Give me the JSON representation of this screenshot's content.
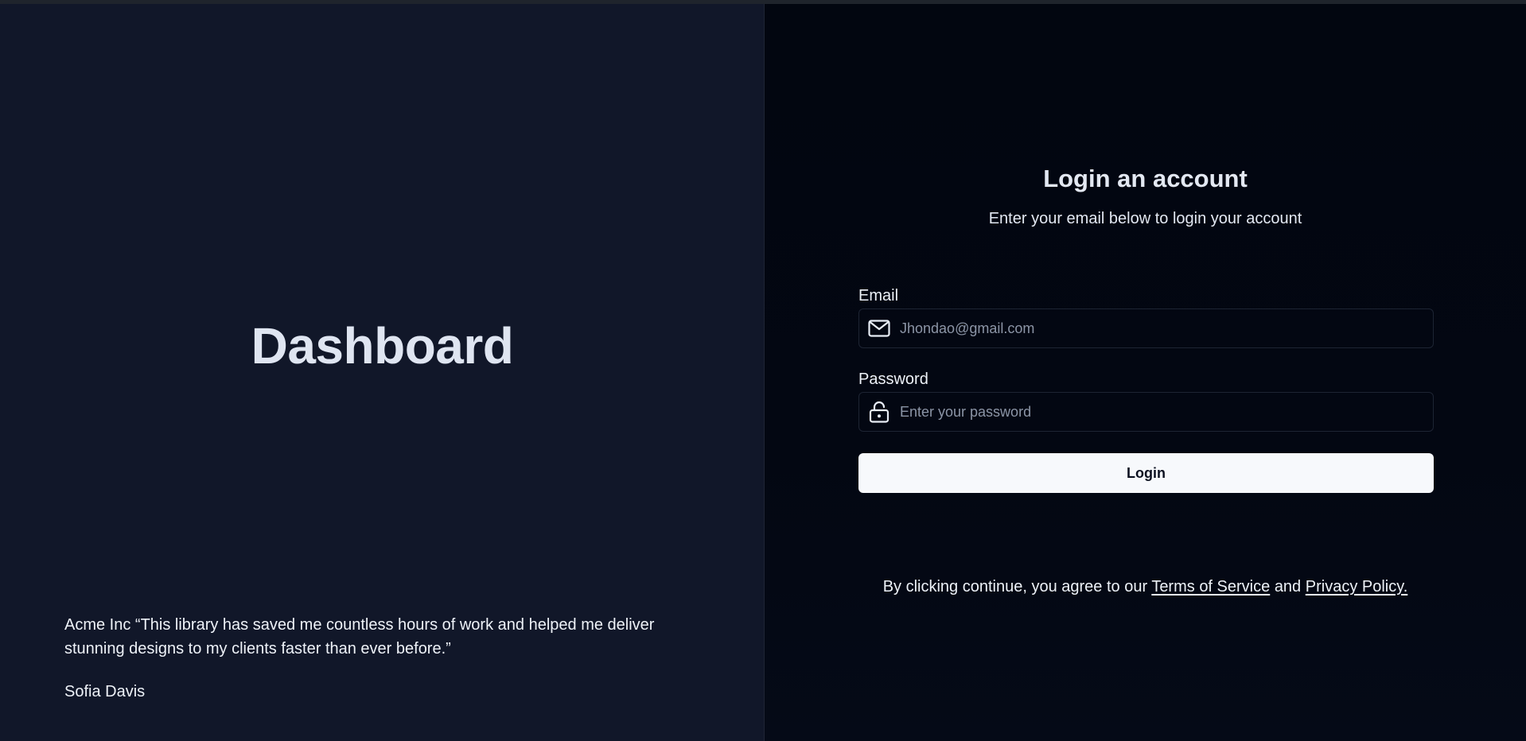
{
  "left": {
    "brand_title": "Dashboard",
    "testimonial": {
      "quote": "Acme Inc “This library has saved me countless hours of work and helped me deliver stunning designs to my clients faster than ever before.”",
      "author": "Sofia Davis"
    }
  },
  "form": {
    "title": "Login an account",
    "subtitle": "Enter your email below to login your account",
    "email": {
      "label": "Email",
      "placeholder": "Jhondao@gmail.com",
      "value": "",
      "icon": "mail-icon"
    },
    "password": {
      "label": "Password",
      "placeholder": "Enter your password",
      "value": "",
      "icon": "lock-icon"
    },
    "submit_label": "Login"
  },
  "legal": {
    "prefix": "By clicking continue, you agree to our",
    "terms_link": "Terms of Service",
    "conjunction": "and",
    "privacy_link": "Privacy Policy."
  },
  "colors": {
    "left_bg": "#111729",
    "right_bg": "#030712",
    "button_bg": "#f7f9fc",
    "text": "#eef2f8"
  }
}
